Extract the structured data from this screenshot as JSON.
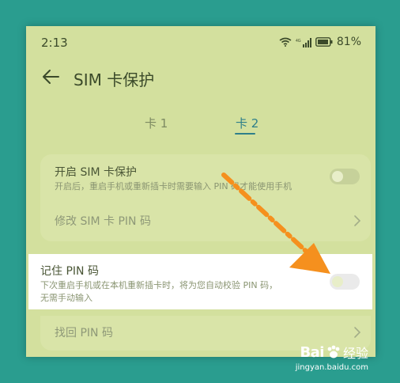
{
  "status": {
    "time": "2:13",
    "battery": "81%"
  },
  "header": {
    "title": "SIM 卡保护"
  },
  "tabs": [
    {
      "label": "卡 1"
    },
    {
      "label": "卡 2"
    }
  ],
  "card1": {
    "enable_title": "开启 SIM 卡保护",
    "enable_sub": "开启后，重启手机或重新插卡时需要输入 PIN 码才能使用手机",
    "modify_title": "修改 SIM 卡 PIN 码"
  },
  "card2": {
    "remember_title": "记住 PIN 码",
    "remember_sub_1": "下次重启手机或在本机重新插卡时，将为您自动校验 PIN 码，",
    "remember_sub_2": "无需手动输入",
    "retrieve_title": "找回 PIN 码"
  },
  "watermark": {
    "brand": "Bai",
    "brand_suffix": "经验",
    "url": "jingyan.baidu.com"
  },
  "colors": {
    "accent": "#2e7f8a",
    "arrow": "#f5901e"
  }
}
